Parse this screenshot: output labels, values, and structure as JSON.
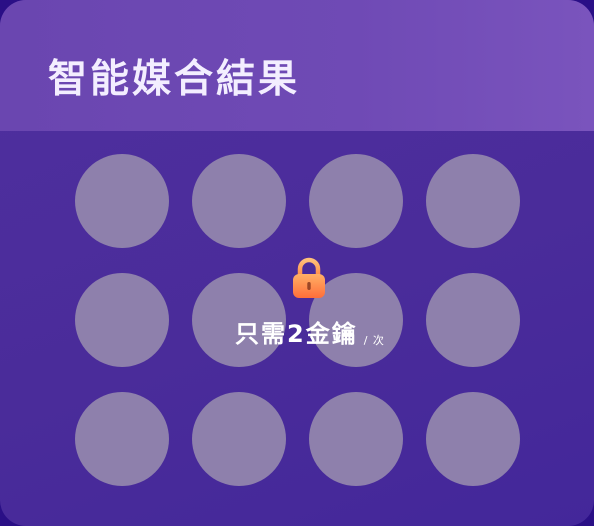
{
  "header": {
    "title": "智能媒合結果"
  },
  "matches": {
    "count": 12,
    "avatars": [
      "",
      "",
      "",
      "",
      "",
      "",
      "",
      "",
      "",
      "",
      "",
      ""
    ]
  },
  "unlock": {
    "icon": "lock-icon",
    "price_label": "只需2金鑰",
    "unit_label": "/ 次"
  },
  "colors": {
    "header_bg": "#6f4ab5",
    "card_bg": "#4a2c9a",
    "avatar_placeholder": "#8e80ac",
    "lock_orange": "#ff8a48"
  }
}
